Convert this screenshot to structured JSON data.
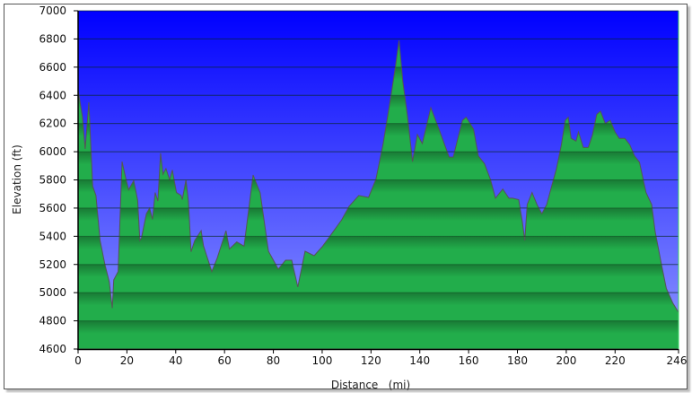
{
  "chart_data": {
    "type": "area",
    "title": "",
    "xlabel": "Distance   (mi)",
    "ylabel": "Elevation (ft)",
    "xlim": [
      0,
      246
    ],
    "ylim": [
      4600,
      7000
    ],
    "xticks": [
      0,
      20,
      40,
      60,
      80,
      100,
      120,
      140,
      160,
      180,
      200,
      220,
      246
    ],
    "yticks": [
      4600,
      4800,
      5000,
      5200,
      5400,
      5600,
      5800,
      6000,
      6200,
      6400,
      6600,
      6800,
      7000
    ],
    "grid": true,
    "colors": {
      "sky_top": "#0000ff",
      "sky_bottom": "#8f98ff",
      "fill_light": "#22ad4b",
      "fill_dark": "#197a35",
      "line": "#555555"
    },
    "series": [
      {
        "name": "Elevation",
        "x": [
          0,
          1.8,
          2.9,
          4.4,
          5.4,
          6,
          7.3,
          9,
          11,
          12.8,
          14,
          14.6,
          16.4,
          18,
          19.5,
          20.7,
          22.8,
          24.4,
          25.3,
          26,
          28,
          29.3,
          30.5,
          31.6,
          32.7,
          33.8,
          34.8,
          36,
          37.5,
          38.6,
          40.3,
          42.2,
          42.7,
          44.2,
          45.2,
          46.3,
          47.8,
          50.4,
          51.4,
          54.8,
          57,
          59.3,
          60.6,
          62,
          65,
          68,
          71.7,
          74.6,
          78,
          82,
          85,
          87.5,
          90,
          93,
          96.7,
          100,
          104,
          108,
          111,
          115,
          119,
          122,
          125,
          128,
          130,
          131.5,
          133,
          135,
          137,
          139,
          141,
          144.5,
          148,
          152,
          153.7,
          156,
          157.5,
          159,
          162,
          164,
          166.5,
          169,
          171,
          174,
          176.5,
          178,
          180.5,
          182,
          183,
          184,
          186,
          188,
          190,
          192,
          194,
          196,
          198,
          199.6,
          200.8,
          202,
          204,
          205,
          207,
          209,
          210.7,
          212.5,
          214,
          216,
          218,
          220,
          221.7,
          224,
          226,
          228,
          230,
          232.7,
          235,
          236.4,
          239,
          241,
          243.7,
          246
        ],
        "y": [
          6436,
          6245,
          6020,
          6350,
          5970,
          5755,
          5690,
          5370,
          5200,
          5075,
          4890,
          5090,
          5150,
          5930,
          5815,
          5730,
          5795,
          5655,
          5370,
          5390,
          5560,
          5600,
          5520,
          5710,
          5650,
          5990,
          5840,
          5880,
          5800,
          5870,
          5710,
          5690,
          5660,
          5800,
          5650,
          5290,
          5370,
          5440,
          5330,
          5150,
          5245,
          5370,
          5440,
          5310,
          5360,
          5330,
          5835,
          5708,
          5294,
          5167,
          5230,
          5230,
          5040,
          5294,
          5262,
          5326,
          5420,
          5517,
          5612,
          5689,
          5676,
          5803,
          6058,
          6376,
          6599,
          6790,
          6503,
          6249,
          5930,
          6122,
          6058,
          6312,
          6153,
          5962,
          5962,
          6122,
          6223,
          6245,
          6160,
          5970,
          5915,
          5800,
          5670,
          5735,
          5670,
          5670,
          5660,
          5500,
          5370,
          5625,
          5710,
          5625,
          5560,
          5625,
          5755,
          5880,
          6050,
          6223,
          6245,
          6095,
          6075,
          6140,
          6030,
          6030,
          6117,
          6265,
          6287,
          6200,
          6223,
          6140,
          6095,
          6095,
          6050,
          5970,
          5925,
          5710,
          5625,
          5435,
          5200,
          5030,
          4925,
          4860
        ]
      }
    ]
  }
}
